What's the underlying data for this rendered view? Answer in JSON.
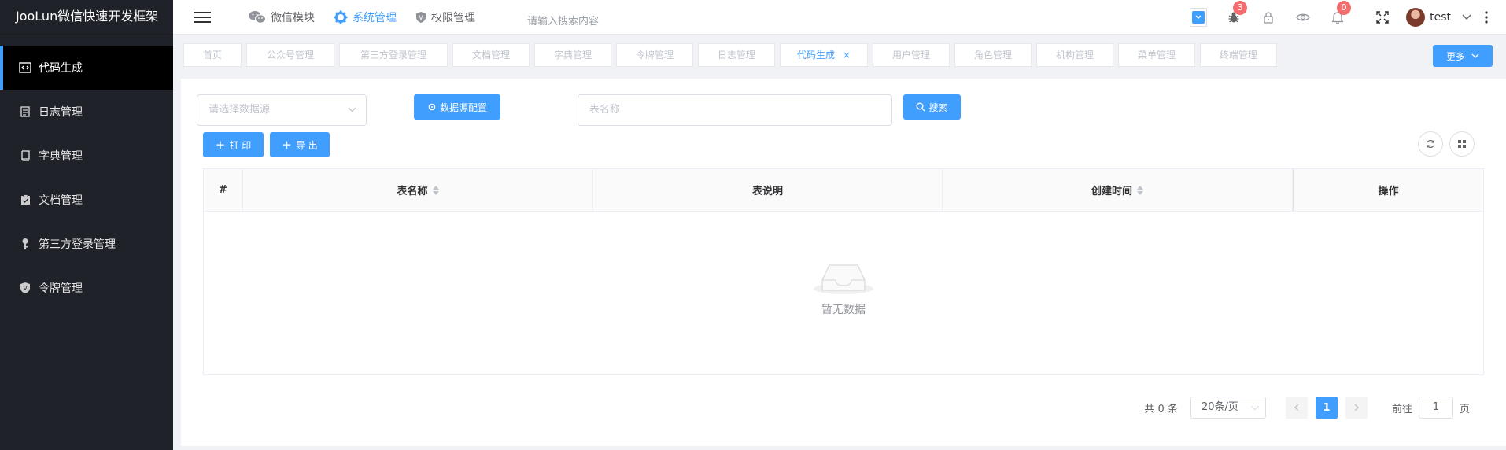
{
  "app": {
    "title": "JooLun微信快速开发框架"
  },
  "sidebar": {
    "items": [
      {
        "label": "代码生成",
        "icon": "code-icon",
        "active": true
      },
      {
        "label": "日志管理",
        "icon": "log-icon"
      },
      {
        "label": "字典管理",
        "icon": "book-icon"
      },
      {
        "label": "文档管理",
        "icon": "doc-check-icon"
      },
      {
        "label": "第三方登录管理",
        "icon": "key-icon"
      },
      {
        "label": "令牌管理",
        "icon": "shield-icon"
      }
    ]
  },
  "topnav": {
    "items": [
      {
        "label": "微信模块",
        "icon": "wechat-icon"
      },
      {
        "label": "系统管理",
        "icon": "gear-icon",
        "active": true
      },
      {
        "label": "权限管理",
        "icon": "shield-icon"
      }
    ],
    "search_placeholder": "请输入搜索内容",
    "bug_badge": "3",
    "notice_badge": "0",
    "username": "test"
  },
  "tabs": {
    "items": [
      "首页",
      "公众号管理",
      "第三方登录管理",
      "文档管理",
      "字典管理",
      "令牌管理",
      "日志管理",
      "代码生成",
      "用户管理",
      "角色管理",
      "机构管理",
      "菜单管理",
      "终端管理"
    ],
    "active_index": 7,
    "more_label": "更多"
  },
  "toolbar": {
    "datasource_placeholder": "请选择数据源",
    "datasource_config_label": "数据源配置",
    "table_name_placeholder": "表名称",
    "search_label": "搜索",
    "print_label": "打 印",
    "export_label": "导 出"
  },
  "table": {
    "columns": [
      "#",
      "表名称",
      "表说明",
      "创建时间",
      "操作"
    ],
    "empty_text": "暂无数据"
  },
  "pagination": {
    "total_text": "共 0 条",
    "page_size": "20条/页",
    "current_page": "1",
    "goto_label": "前往",
    "goto_value": "1",
    "page_unit": "页"
  },
  "colors": {
    "accent": "#409eff",
    "sidebar_bg": "#20222a",
    "badge": "#f56c6c"
  }
}
